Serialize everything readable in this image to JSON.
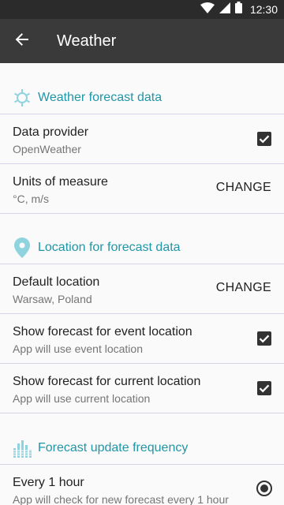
{
  "status_bar": {
    "time": "12:30",
    "icons": [
      "wifi-icon",
      "signal-icon",
      "battery-icon"
    ]
  },
  "app_bar": {
    "title": "Weather",
    "back_icon": "arrow-back-icon"
  },
  "colors": {
    "accent": "#2196a6",
    "icon_accent": "#8fd3df",
    "app_bar": "#3a3a3a",
    "status_bar": "#2b2b2b",
    "divider": "#d7d4ea"
  },
  "sections": {
    "forecast_data": {
      "title": "Weather forecast data",
      "icon": "sun-icon",
      "rows": {
        "provider": {
          "title": "Data provider",
          "subtitle": "OpenWeather",
          "checked": true
        },
        "units": {
          "title": "Units of measure",
          "subtitle": "°C, m/s",
          "action": "CHANGE"
        }
      }
    },
    "location": {
      "title": "Location for forecast data",
      "icon": "location-pin-icon",
      "rows": {
        "default_location": {
          "title": "Default location",
          "subtitle": "Warsaw, Poland",
          "action": "CHANGE"
        },
        "event_location": {
          "title": "Show forecast for event location",
          "subtitle": "App will use event location",
          "checked": true
        },
        "current_location": {
          "title": "Show forecast for current location",
          "subtitle": "App will use current location",
          "checked": true
        }
      }
    },
    "frequency": {
      "title": "Forecast update frequency",
      "icon": "equalizer-icon",
      "rows": {
        "every_hour": {
          "title": "Every 1 hour",
          "subtitle": "App will check for new forecast every 1 hour",
          "selected": true
        }
      }
    }
  }
}
